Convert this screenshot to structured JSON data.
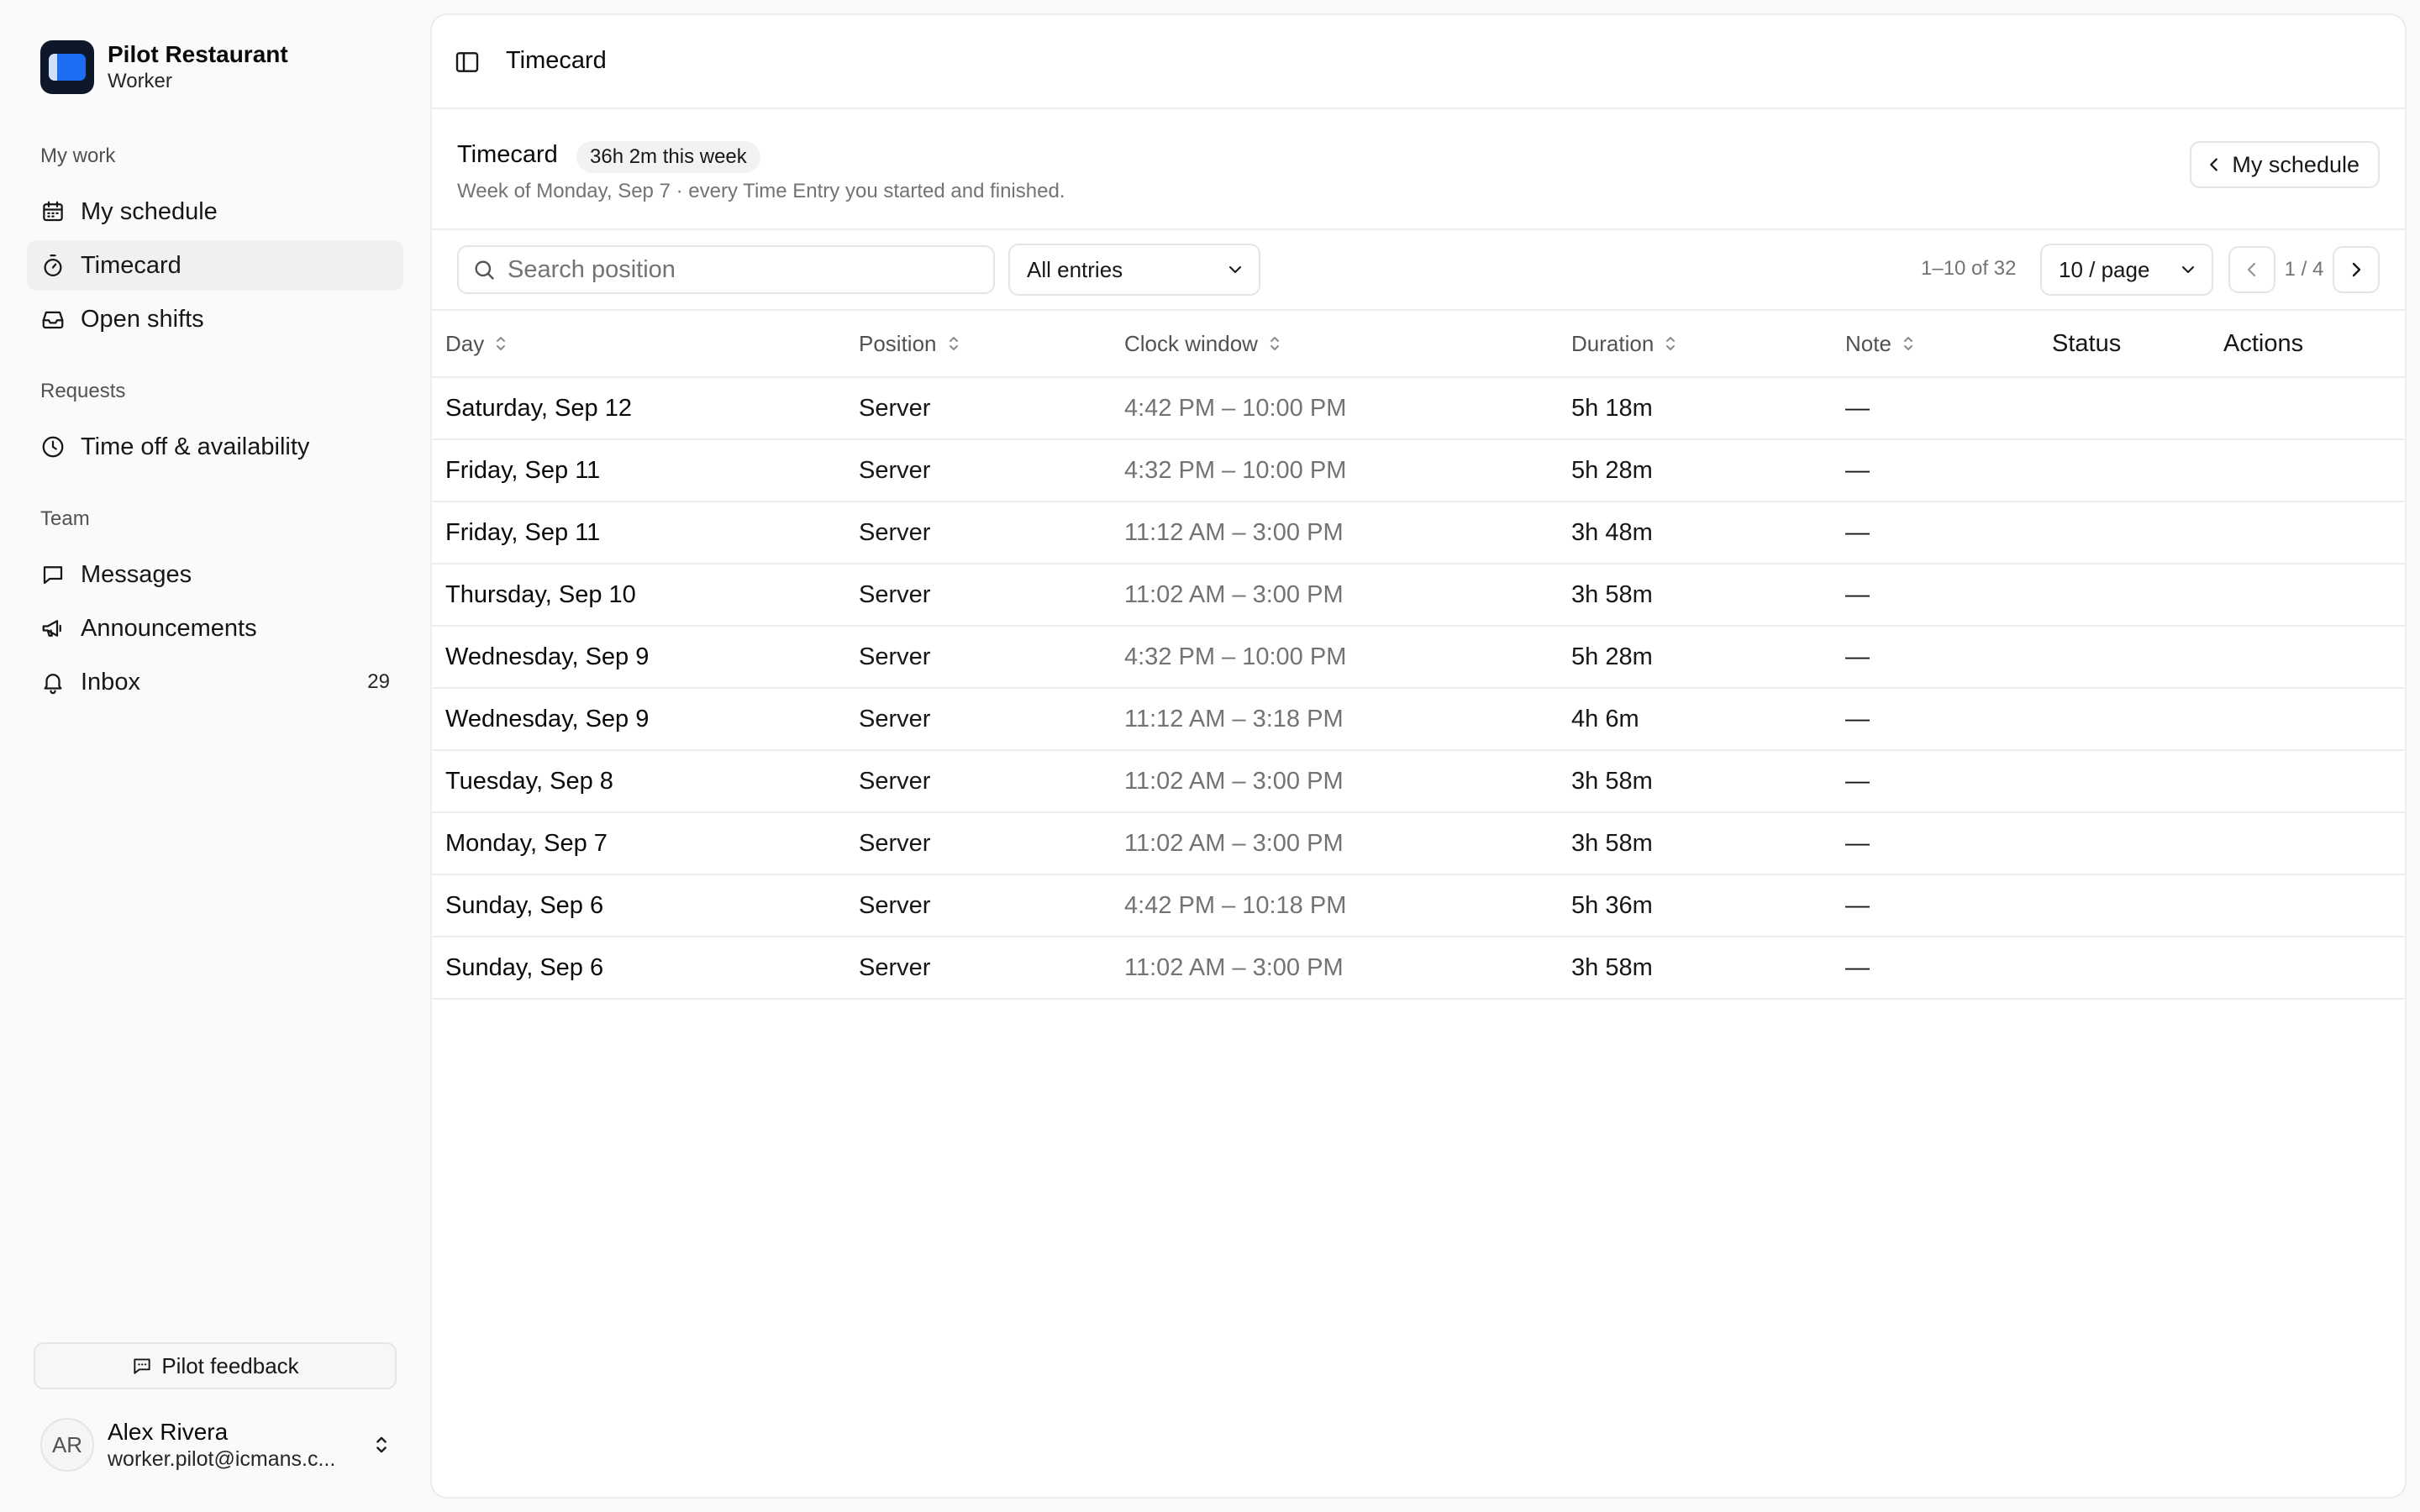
{
  "brand": {
    "name": "Pilot Restaurant",
    "role": "Worker"
  },
  "sidebar": {
    "sections": [
      {
        "label": "My work"
      },
      {
        "label": "Requests"
      },
      {
        "label": "Team"
      }
    ],
    "items": [
      {
        "label": "My schedule",
        "icon": "calendar-icon"
      },
      {
        "label": "Timecard",
        "icon": "stopwatch-icon",
        "active": true
      },
      {
        "label": "Open shifts",
        "icon": "inbox-tray-icon"
      },
      {
        "label": "Time off & availability",
        "icon": "clock-icon"
      },
      {
        "label": "Messages",
        "icon": "message-square-icon"
      },
      {
        "label": "Announcements",
        "icon": "megaphone-icon"
      },
      {
        "label": "Inbox",
        "icon": "bell-icon",
        "count": "29"
      }
    ],
    "feedback_label": "Pilot feedback",
    "user": {
      "initials": "AR",
      "name": "Alex Rivera",
      "email": "worker.pilot@icmans.c..."
    }
  },
  "topbar": {
    "title": "Timecard"
  },
  "header": {
    "title": "Timecard",
    "badge": "36h 2m this week",
    "subtitle": "Week of Monday, Sep 7 · every Time Entry you started and finished.",
    "schedule_button": "My schedule"
  },
  "toolbar": {
    "search_placeholder": "Search position",
    "search_value": "",
    "filter_value": "All entries",
    "range_text": "1–10 of 32",
    "page_size": "10 / page",
    "page_indicator": "1 / 4"
  },
  "table": {
    "columns": [
      "Day",
      "Position",
      "Clock window",
      "Duration",
      "Note",
      "Status",
      "Actions"
    ],
    "rows": [
      {
        "day": "Saturday, Sep 12",
        "position": "Server",
        "clock": "4:42 PM – 10:00 PM",
        "duration": "5h 18m",
        "note": "—"
      },
      {
        "day": "Friday, Sep 11",
        "position": "Server",
        "clock": "4:32 PM – 10:00 PM",
        "duration": "5h 28m",
        "note": "—"
      },
      {
        "day": "Friday, Sep 11",
        "position": "Server",
        "clock": "11:12 AM – 3:00 PM",
        "duration": "3h 48m",
        "note": "—"
      },
      {
        "day": "Thursday, Sep 10",
        "position": "Server",
        "clock": "11:02 AM – 3:00 PM",
        "duration": "3h 58m",
        "note": "—"
      },
      {
        "day": "Wednesday, Sep 9",
        "position": "Server",
        "clock": "4:32 PM – 10:00 PM",
        "duration": "5h 28m",
        "note": "—"
      },
      {
        "day": "Wednesday, Sep 9",
        "position": "Server",
        "clock": "11:12 AM – 3:18 PM",
        "duration": "4h 6m",
        "note": "—"
      },
      {
        "day": "Tuesday, Sep 8",
        "position": "Server",
        "clock": "11:02 AM – 3:00 PM",
        "duration": "3h 58m",
        "note": "—"
      },
      {
        "day": "Monday, Sep 7",
        "position": "Server",
        "clock": "11:02 AM – 3:00 PM",
        "duration": "3h 58m",
        "note": "—"
      },
      {
        "day": "Sunday, Sep 6",
        "position": "Server",
        "clock": "4:42 PM – 10:18 PM",
        "duration": "5h 36m",
        "note": "—"
      },
      {
        "day": "Sunday, Sep 6",
        "position": "Server",
        "clock": "11:02 AM – 3:00 PM",
        "duration": "3h 58m",
        "note": "—"
      }
    ]
  }
}
